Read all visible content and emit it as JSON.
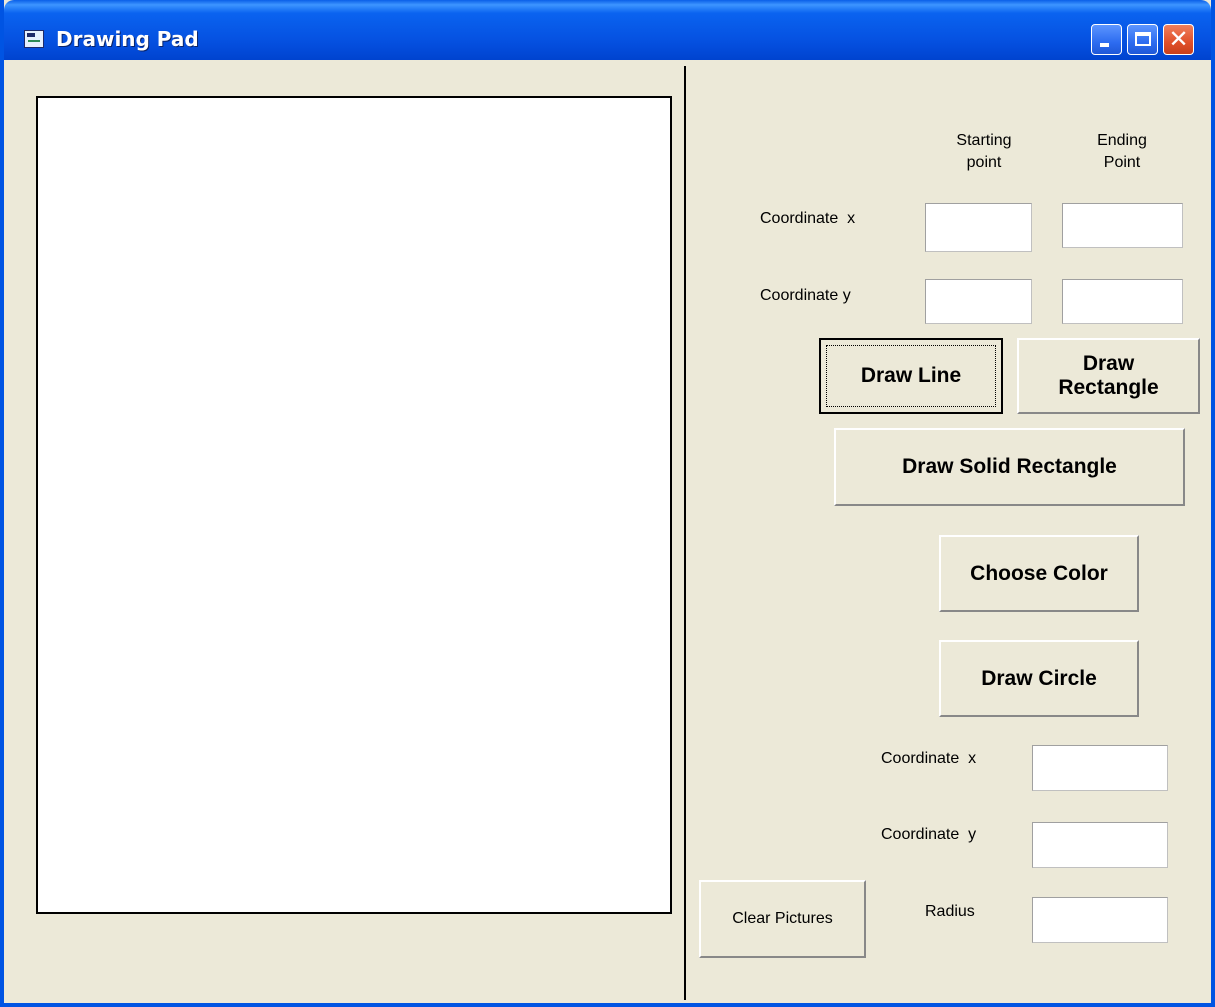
{
  "window": {
    "title": "Drawing Pad"
  },
  "labels": {
    "starting_point": "Starting\npoint",
    "ending_point": "Ending\nPoint",
    "coord_x": "Coordinate  x",
    "coord_y": "Coordinate y",
    "circle_coord_x": "Coordinate  x",
    "circle_coord_y": "Coordinate  y",
    "radius": "Radius"
  },
  "buttons": {
    "draw_line": "Draw Line",
    "draw_rectangle": "Draw\nRectangle",
    "draw_solid_rectangle": "Draw Solid Rectangle",
    "choose_color": "Choose Color",
    "draw_circle": "Draw Circle",
    "clear_pictures": "Clear Pictures"
  },
  "fields": {
    "start_x": "",
    "end_x": "",
    "start_y": "",
    "end_y": "",
    "circle_x": "",
    "circle_y": "",
    "radius": ""
  }
}
